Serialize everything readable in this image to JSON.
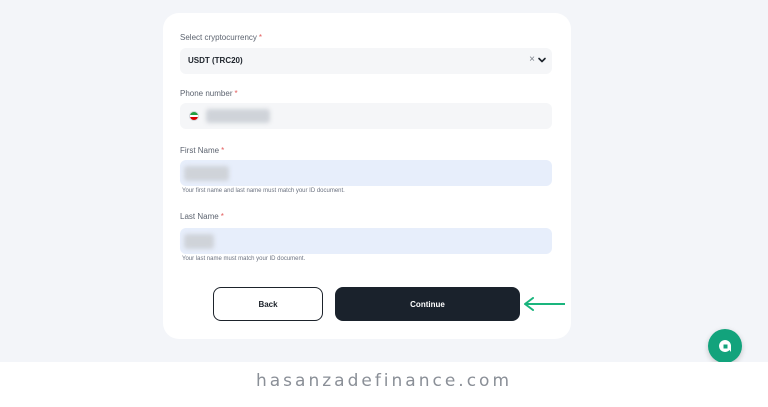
{
  "form": {
    "crypto_label": "Select cryptocurrency",
    "crypto_value": "USDT (TRC20)",
    "clear_glyph": "×",
    "phone_label": "Phone number",
    "first_name_label": "First Name",
    "first_name_hint": "Your first name and last name must match your ID document.",
    "last_name_label": "Last Name",
    "last_name_hint": "Your last name must match your ID document.",
    "required_mark": "*"
  },
  "buttons": {
    "back": "Back",
    "continue": "Continue"
  },
  "colors": {
    "accent_green": "#12a37c",
    "arrow_green": "#1ab57d",
    "dark_button": "#1a222c",
    "required": "#e35d5d"
  },
  "icons": {
    "clear": "close-icon",
    "dropdown": "chevron-down-icon",
    "flag": "iran-flag-icon",
    "chat": "chat-icon"
  },
  "watermark": "hasanzadefinance.com"
}
